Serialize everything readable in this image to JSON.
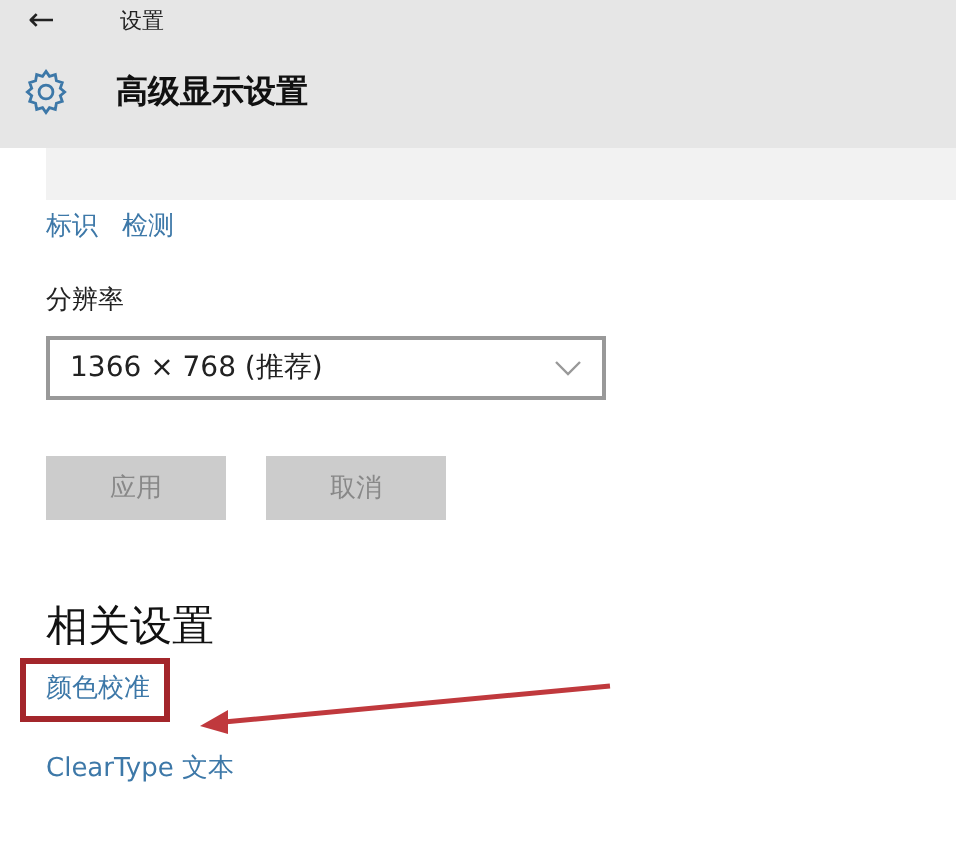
{
  "header": {
    "back_icon": "←",
    "app_title": "设置",
    "page_title": "高级显示设置"
  },
  "display_links": [
    {
      "label": "标识"
    },
    {
      "label": "检测"
    }
  ],
  "resolution": {
    "label": "分辨率",
    "value": "1366 × 768 (推荐)"
  },
  "buttons": [
    {
      "label": "应用",
      "disabled": true
    },
    {
      "label": "取消",
      "disabled": true
    }
  ],
  "related": {
    "heading": "相关设置",
    "links": [
      {
        "label": "颜色校准",
        "highlighted": true
      },
      {
        "label": "ClearType 文本",
        "highlighted": false
      }
    ]
  }
}
